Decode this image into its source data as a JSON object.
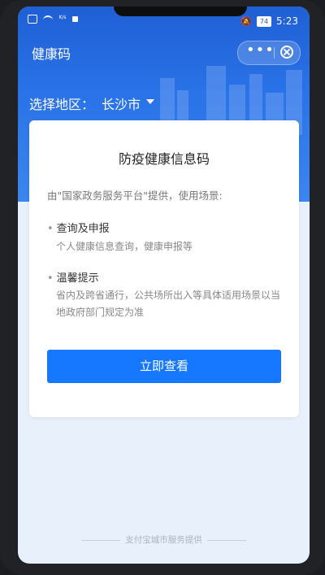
{
  "status_bar": {
    "network_speed": "K/s",
    "battery": "74",
    "time": "5:23"
  },
  "app": {
    "title": "健康码",
    "more_label": "•••"
  },
  "region": {
    "label": "选择地区：",
    "value": "长沙市"
  },
  "card": {
    "title": "防疫健康信息码",
    "intro": "由\"国家政务服务平台\"提供，使用场景:",
    "sections": [
      {
        "title": "查询及申报",
        "desc": "个人健康信息查询，健康申报等"
      },
      {
        "title": "温馨提示",
        "desc": "省内及跨省通行，公共场所出入等具体适用场景以当地政府部门规定为准"
      }
    ],
    "button_label": "立即查看"
  },
  "footer": {
    "text": "支付宝城市服务提供"
  },
  "colors": {
    "header_blue": "#1f5fd4",
    "button_blue": "#1677ff",
    "page_bg": "#e8f0fb"
  }
}
